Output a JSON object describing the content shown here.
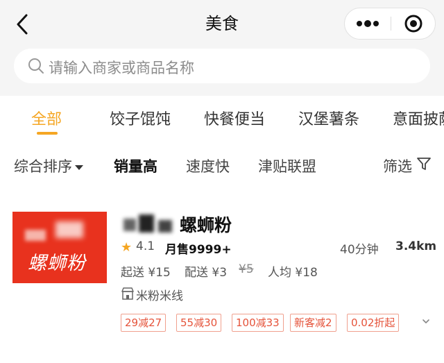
{
  "header": {
    "title": "美食",
    "back_icon": "chevron-left-icon",
    "more_icon": "more-dots-icon",
    "close_icon": "target-close-icon"
  },
  "search": {
    "placeholder": "请输入商家或商品名称",
    "icon": "search-icon"
  },
  "categories": [
    {
      "label": "全部",
      "active": true
    },
    {
      "label": "饺子馄饨",
      "active": false
    },
    {
      "label": "快餐便当",
      "active": false
    },
    {
      "label": "汉堡薯条",
      "active": false
    },
    {
      "label": "意面披萨",
      "active": false
    }
  ],
  "sort": {
    "items": [
      {
        "label": "综合排序",
        "dropdown": true,
        "bold": false
      },
      {
        "label": "销量高",
        "dropdown": false,
        "bold": true
      },
      {
        "label": "速度快",
        "dropdown": false,
        "bold": false
      },
      {
        "label": "津贴联盟",
        "dropdown": false,
        "bold": false
      }
    ],
    "filter_label": "筛选",
    "filter_icon": "filter-funnel-icon"
  },
  "shop": {
    "logo_text": "螺蛳粉",
    "name": "螺蛳粉",
    "rating": "4.1",
    "monthly_sales": "月售9999+",
    "delivery_time": "40分钟",
    "distance": "3.4km",
    "min_order": "起送 ¥15",
    "delivery_fee": "配送 ¥3",
    "original_fee": "¥5",
    "per_capita": "人均 ¥18",
    "category": "米粉米线",
    "tags": [
      "29减27",
      "55减30",
      "100减33",
      "新客减2",
      "0.02折起"
    ]
  },
  "colors": {
    "accent": "#f5a623",
    "tag_red": "#e5533a",
    "logo_red": "#e8321e"
  }
}
